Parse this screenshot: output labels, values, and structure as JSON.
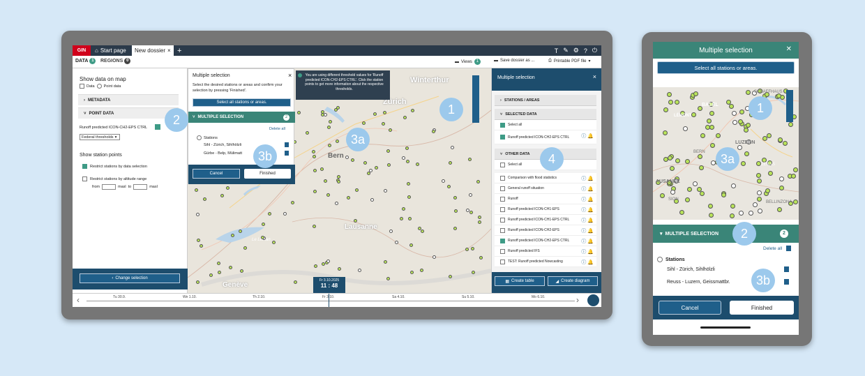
{
  "laptop": {
    "top_tabs": {
      "gin": "GIN",
      "start": "Start page",
      "new": "New dossier",
      "add": "+"
    },
    "top_icons": [
      "T",
      "✎",
      "⚙",
      "?",
      "⏻"
    ],
    "tabs": {
      "data": "DATA",
      "data_count": "1",
      "regions": "REGIONS",
      "regions_count": "0"
    },
    "toolbar": {
      "views": "Views",
      "views_count": "1",
      "save": "Save dossier as ...",
      "pdf": "Printable PDF file"
    },
    "left": {
      "show_data": "Show data on map",
      "opt_data": "Data",
      "opt_point": "Point data",
      "metadata": "METADATA",
      "point_data": "POINT DATA",
      "runoff": "Runoff predicted ICON-CH2-EPS CTRL",
      "thresholds": "Federal thresholds",
      "show_station": "Show station points",
      "restrict1": "Restrict stations by data selection",
      "restrict2": "Restrict stations by altitude range",
      "from": "from",
      "masl1": "masl",
      "to": "to",
      "masl2": "masl",
      "change": "Change selection"
    },
    "popup": {
      "title": "Multiple selection",
      "desc": "Select the desired stations or areas and confirm your selection by pressing 'Finished'.",
      "select_all": "Select all stations or areas.",
      "multiple": "MULTIPLE SELECTION",
      "count": "2",
      "delete_all": "Delete all",
      "stations": "Stations",
      "station1": "Sihl - Zürich, Sihlhölzli",
      "station2": "Gürbe - Belp, Mülimatt",
      "cancel": "Cancel",
      "finished": "Finished"
    },
    "info": "You are using different threshold values for 'Runoff predicted ICON-CH2-EPS CTRL'. Click the station points to get more information about the respective thresholds.",
    "map_labels": {
      "winterthur": "Winterthur",
      "zurich": "Zürich",
      "bern": "Bern",
      "lausanne": "Lausanne",
      "geneve": "Genève",
      "leman": "Le Léman"
    },
    "right": {
      "title": "Multiple selection",
      "stations_areas": "STATIONS / AREAS",
      "selected": "SELECTED DATA",
      "select_all": "Select all",
      "selected_item": "Runoff predicted ICON-CH2-EPS CTRL",
      "other": "OTHER DATA",
      "select_all2": "Select all",
      "items": [
        {
          "label": "Comparison with flood statistics",
          "checked": false
        },
        {
          "label": "General runoff situation",
          "checked": false
        },
        {
          "label": "Runoff",
          "checked": false
        },
        {
          "label": "Runoff predicted ICON-CH1-EPS",
          "checked": false
        },
        {
          "label": "Runoff predicted ICON-CH1-EPS CTRL",
          "checked": false
        },
        {
          "label": "Runoff predicted ICON-CH2-EPS",
          "checked": false
        },
        {
          "label": "Runoff predicted ICON-CH2-EPS CTRL",
          "checked": true
        },
        {
          "label": "Runoff predicted IFS",
          "checked": false
        },
        {
          "label": "TEST: Runoff predicted Nowcasting",
          "checked": false
        }
      ],
      "create_table": "Create table",
      "create_diagram": "Create diagram"
    },
    "timeline": {
      "days": [
        "Tu 30.9.",
        "We 1.10.",
        "Th 2.10.",
        "Fr 3.10.",
        "Sa 4.10.",
        "Su 5.10.",
        "Mo 6.10."
      ],
      "date": "Fr 3.10.2025",
      "time": "11 : 48"
    }
  },
  "markers": {
    "m1": "1",
    "m2": "2",
    "m3a": "3a",
    "m3b": "3b",
    "m4": "4"
  },
  "phone": {
    "title": "Multiple selection",
    "close": "✕",
    "select_all": "Select all stations or areas.",
    "map_labels": {
      "schaffhaus": "SCHAFFHAUS",
      "basel": "BASEL",
      "lemont": "LÉMONT",
      "luzern": "LUZERN",
      "bern": "BERN",
      "sane": "AUSANNE",
      "sion": "SION",
      "bellinzona": "BELLINZONA",
      "zeras": "ZERAS"
    },
    "multiple": "MULTIPLE SELECTION",
    "count": "2",
    "delete_all": "Delete all",
    "stations": "Stations",
    "station1": "Sihl - Zürich, Sihlhölzli",
    "station2": "Reuss - Luzern, Geissmattbr.",
    "cancel": "Cancel",
    "finished": "Finished"
  }
}
